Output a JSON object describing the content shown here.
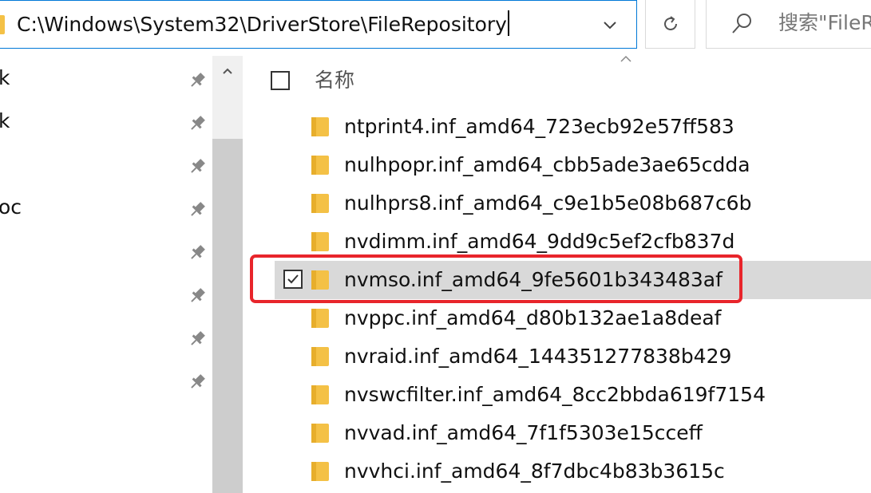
{
  "address_bar": {
    "path": "C:\\Windows\\System32\\DriverStore\\FileRepository"
  },
  "search": {
    "placeholder": "搜索\"FileRepository\""
  },
  "icons": {
    "refresh": "refresh-icon",
    "search": "search-icon",
    "dropdown": "chevron-down-icon",
    "pin": "pin-icon",
    "folder": "folder-icon",
    "checkbox": "checkbox-icon",
    "sort": "sort-ascending-icon"
  },
  "nav": {
    "items": [
      {
        "label": "k"
      },
      {
        "label": "k"
      },
      {
        "label": ""
      },
      {
        "label": "oc"
      },
      {
        "label": ""
      },
      {
        "label": ""
      },
      {
        "label": ""
      },
      {
        "label": ""
      }
    ]
  },
  "list": {
    "column_name": "名称",
    "rows": [
      {
        "name": "ntprint4.inf_amd64_723ecb92e57ff583",
        "selected": false
      },
      {
        "name": "nulhpopr.inf_amd64_cbb5ade3ae65cdda",
        "selected": false
      },
      {
        "name": "nulhprs8.inf_amd64_c9e1b5e08b687c6b",
        "selected": false
      },
      {
        "name": "nvdimm.inf_amd64_9dd9c5ef2cfb837d",
        "selected": false
      },
      {
        "name": "nvmso.inf_amd64_9fe5601b343483af",
        "selected": true
      },
      {
        "name": "nvppc.inf_amd64_d80b132ae1a8deaf",
        "selected": false
      },
      {
        "name": "nvraid.inf_amd64_144351277838b429",
        "selected": false
      },
      {
        "name": "nvswcfilter.inf_amd64_8cc2bbda619f7154",
        "selected": false
      },
      {
        "name": "nvvad.inf_amd64_7f1f5303e15cceff",
        "selected": false
      },
      {
        "name": "nvvhci.inf_amd64_8f7dbc4b83b3615c",
        "selected": false
      }
    ]
  },
  "colors": {
    "accent": "#0078d7",
    "folder": "#f4c146",
    "selection": "#d9d9d9",
    "highlight": "#e8252b"
  }
}
